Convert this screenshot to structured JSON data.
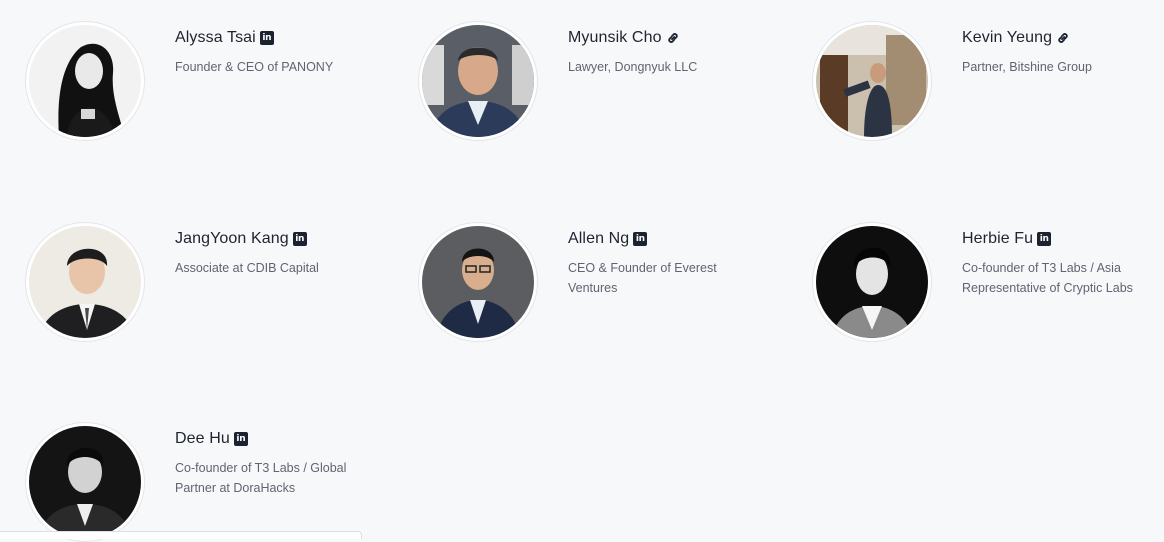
{
  "people": [
    {
      "name": "Alyssa Tsai",
      "role": "Founder & CEO of PANONY",
      "link_icon": "linkedin-icon"
    },
    {
      "name": "Myunsik Cho",
      "role": "Lawyer, Dongnyuk LLC",
      "link_icon": "link-icon"
    },
    {
      "name": "Kevin Yeung",
      "role": "Partner, Bitshine Group",
      "link_icon": "link-icon"
    },
    {
      "name": "JangYoon Kang",
      "role": "Associate at CDIB Capital",
      "link_icon": "linkedin-icon"
    },
    {
      "name": "Allen Ng",
      "role": "CEO & Founder of Everest Ventures",
      "link_icon": "linkedin-icon"
    },
    {
      "name": "Herbie Fu",
      "role": "Co-founder of T3 Labs / Asia Representative of Cryptic Labs",
      "link_icon": "linkedin-icon"
    },
    {
      "name": "Dee Hu",
      "role": "Co-founder of T3 Labs / Global Partner at DoraHacks",
      "link_icon": "linkedin-icon"
    }
  ],
  "icons": {
    "linkedin_glyph": "in"
  },
  "colors": {
    "background": "#f7f8fa",
    "name_text": "#1f2430",
    "role_text": "#5f6470",
    "icon_dark": "#1b2230"
  }
}
